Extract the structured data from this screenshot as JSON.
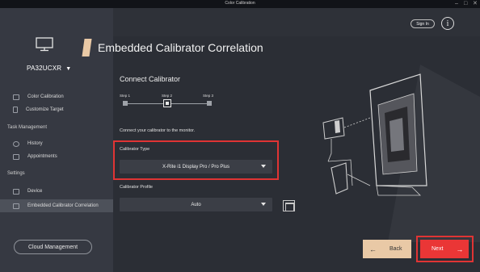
{
  "window": {
    "title": "Color Calibration",
    "controls": [
      "–",
      "□",
      "✕"
    ]
  },
  "device": {
    "model": "PA32UCXR",
    "model_caret": "▼",
    "monitor_icon": "monitor-icon"
  },
  "sidebar": {
    "items_top": [
      {
        "label": "Color Calibration",
        "icon": "calibration-icon"
      },
      {
        "label": "Customize Target",
        "icon": "target-icon"
      }
    ],
    "section_task": "Task Management",
    "items_task": [
      {
        "label": "History",
        "icon": "history-icon"
      },
      {
        "label": "Appointments",
        "icon": "calendar-icon"
      }
    ],
    "section_settings": "Settings",
    "items_settings": [
      {
        "label": "Device",
        "icon": "device-icon"
      },
      {
        "label": "Embedded Calibrator Correlation",
        "icon": "calibrator-icon",
        "active": true
      }
    ],
    "cloud_button": "Cloud Management"
  },
  "header": {
    "sign_in": "Sign In",
    "info": "i"
  },
  "main": {
    "title": "Embedded Calibrator Correlation",
    "subtitle": "Connect Calibrator",
    "steps": [
      {
        "label": "Step 1"
      },
      {
        "label": "Step 2",
        "current": true
      },
      {
        "label": "Step 3"
      }
    ],
    "prompt": "Connect your calibrator to the monitor.",
    "calibrator_type": {
      "label": "Calibrator Type",
      "value": "X-Rite i1 Display Pro / Pro Plus"
    },
    "calibrator_profile": {
      "label": "Calibrator Profile",
      "value": "Auto"
    }
  },
  "footer": {
    "back": "Back",
    "back_arrow": "←",
    "next": "Next",
    "next_arrow": "→"
  },
  "colors": {
    "accent": "#e9c9a6",
    "highlight": "#e03434",
    "next_bg": "#ea3636",
    "sidebar_bg": "#363942",
    "main_bg": "#2b2e35"
  }
}
